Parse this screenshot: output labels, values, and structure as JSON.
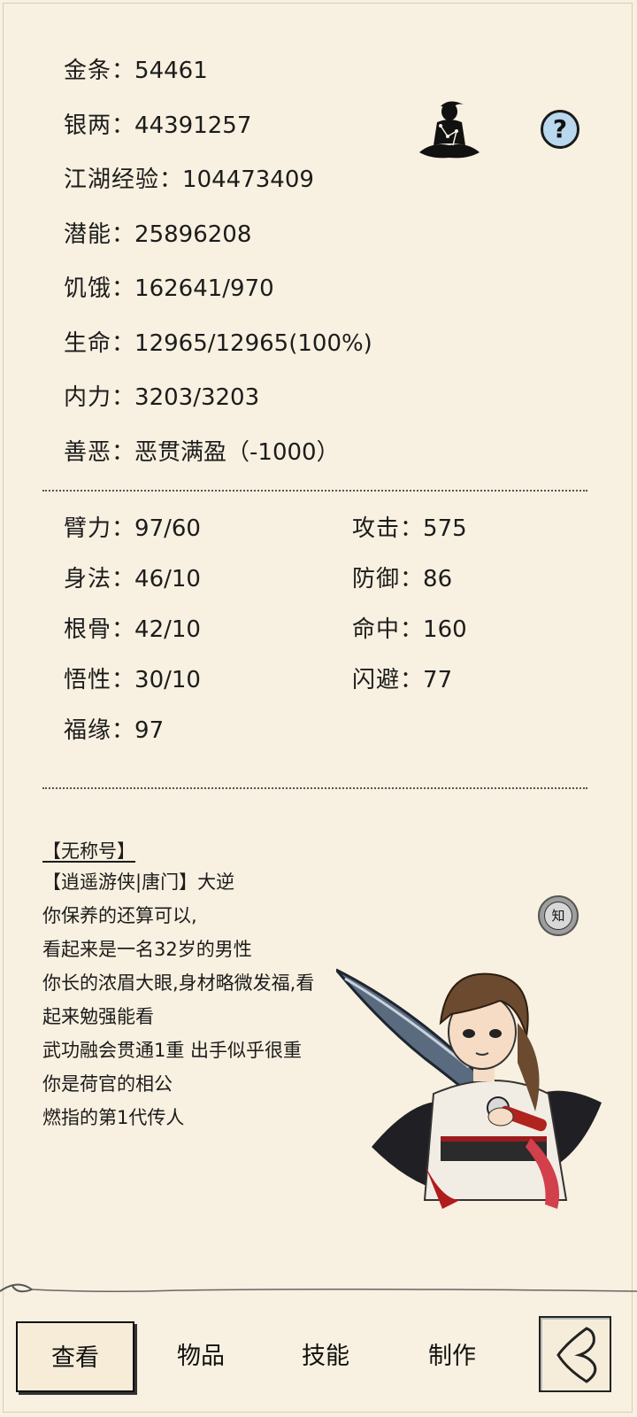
{
  "stats": [
    {
      "label": "金条",
      "value": "54461"
    },
    {
      "label": "银两",
      "value": "44391257"
    },
    {
      "label": "江湖经验",
      "value": "104473409"
    },
    {
      "label": "潜能",
      "value": "25896208"
    },
    {
      "label": "饥饿",
      "value": "162641/970"
    },
    {
      "label": "生命",
      "value": "12965/12965(100%)"
    },
    {
      "label": "内力",
      "value": "3203/3203"
    },
    {
      "label": "善恶",
      "value": "恶贯满盈（-1000）"
    }
  ],
  "separator": "：",
  "attributes_left": [
    {
      "label": "臂力",
      "value": "97/60"
    },
    {
      "label": "身法",
      "value": "46/10"
    },
    {
      "label": "根骨",
      "value": "42/10"
    },
    {
      "label": "悟性",
      "value": "30/10"
    },
    {
      "label": "福缘",
      "value": "97"
    }
  ],
  "attributes_right": [
    {
      "label": "攻击",
      "value": "575"
    },
    {
      "label": "防御",
      "value": "86"
    },
    {
      "label": "命中",
      "value": "160"
    },
    {
      "label": "闪避",
      "value": "77"
    }
  ],
  "help_label": "?",
  "description": {
    "title": "【无称号】",
    "lines": [
      "【逍遥游侠|唐门】大逆",
      "你保养的还算可以,",
      "看起来是一名32岁的男性",
      "你长的浓眉大眼,身材略微发福,看",
      "起来勉强能看",
      "武功融会贯通1重 出手似乎很重",
      "你是荷官的相公",
      "燃指的第1代传人"
    ]
  },
  "zhi_label": "知",
  "nav": {
    "items": [
      {
        "label": "查看",
        "active": true
      },
      {
        "label": "物品",
        "active": false
      },
      {
        "label": "技能",
        "active": false
      },
      {
        "label": "制作",
        "active": false
      }
    ]
  },
  "icons": {
    "meditate": "meditating-figure-icon",
    "help": "question-mark-icon",
    "zhi": "knowledge-icon",
    "back": "back-arrow-icon"
  },
  "colors": {
    "background": "#f8f0e0",
    "help_bg": "#b9d8ee",
    "text": "#1c1c1c"
  }
}
